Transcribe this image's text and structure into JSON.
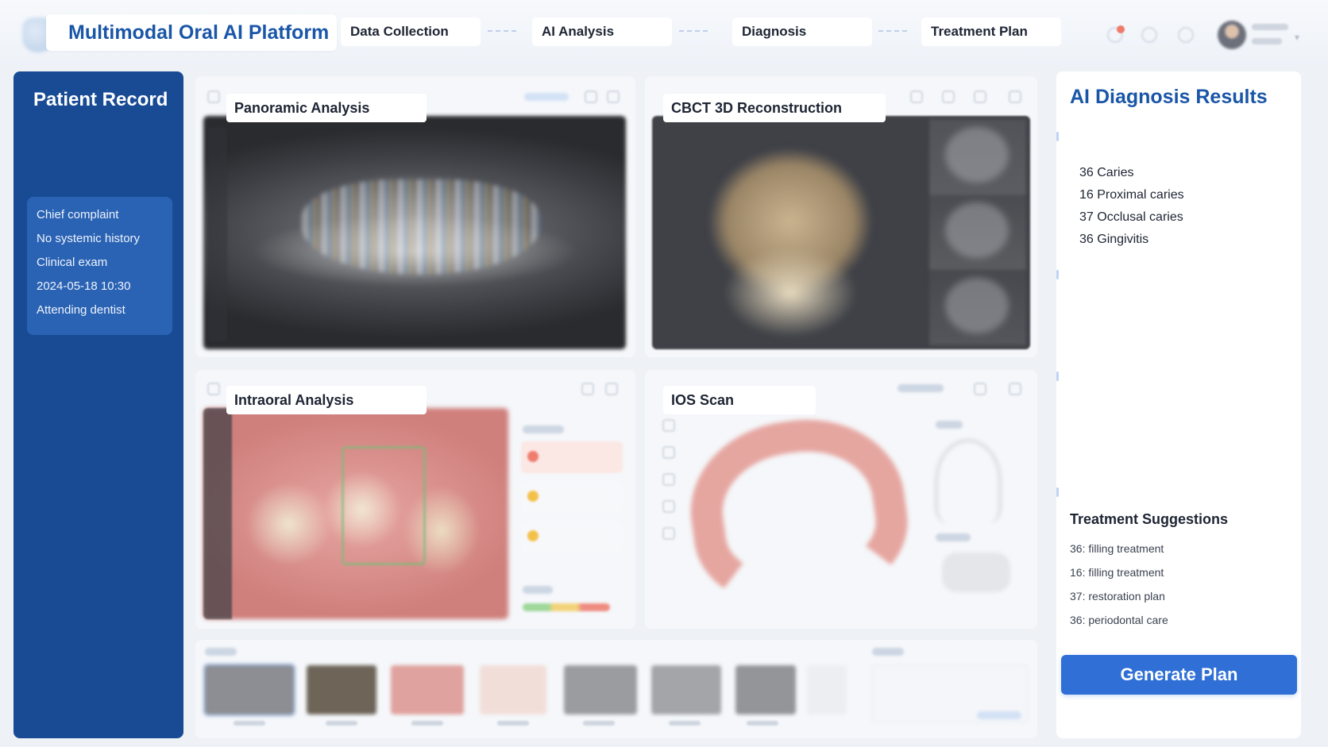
{
  "header": {
    "title": "Multimodal Oral AI Platform",
    "steps": [
      {
        "label": "Data Collection"
      },
      {
        "label": "AI Analysis"
      },
      {
        "label": "Diagnosis"
      },
      {
        "label": "Treatment Plan"
      }
    ]
  },
  "sidebar": {
    "title": "Patient Record",
    "items": [
      {
        "label": "Chief complaint"
      },
      {
        "label": "No systemic history"
      },
      {
        "label": "Clinical exam"
      },
      {
        "label": "2024-05-18 10:30"
      },
      {
        "label": "Attending dentist"
      }
    ]
  },
  "panels": {
    "panoramic": {
      "title": "Panoramic Analysis"
    },
    "cbct": {
      "title": "CBCT 3D Reconstruction"
    },
    "intraoral": {
      "title": "Intraoral Analysis"
    },
    "ios": {
      "title": "IOS Scan"
    }
  },
  "results": {
    "title": "AI Diagnosis Results",
    "items": [
      {
        "label": "36 Caries"
      },
      {
        "label": "16 Proximal caries"
      },
      {
        "label": "37 Occlusal caries"
      },
      {
        "label": "36 Gingivitis"
      }
    ],
    "suggestions_title": "Treatment Suggestions",
    "suggestions": [
      {
        "label": "36: filling treatment"
      },
      {
        "label": "16: filling treatment"
      },
      {
        "label": "37: restoration plan"
      },
      {
        "label": "36: periodontal care"
      }
    ],
    "generate_label": "Generate Plan"
  },
  "colors": {
    "primary": "#184b94",
    "accent": "#2f6fd6",
    "title_blue": "#1a56a8",
    "alert": "#f07a6a"
  },
  "icons": [
    "tooth-logo-icon",
    "bell-icon",
    "help-icon",
    "settings-icon",
    "user-avatar",
    "chevron-down-icon"
  ]
}
